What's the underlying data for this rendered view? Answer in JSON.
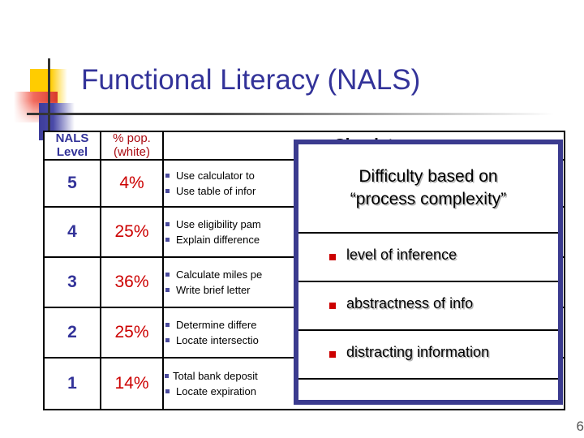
{
  "slide": {
    "title": "Functional Literacy (NALS)",
    "title_color": "#333399",
    "page_number": "6"
  },
  "table": {
    "headers": {
      "level": "NALS\nLevel",
      "level_line1": "NALS",
      "level_line2": "Level",
      "pct_line1": "% pop.",
      "pct_line2": "(white)",
      "tasks": "Simulat"
    },
    "header_colors": {
      "level": "#333399",
      "pct": "#AA0B12",
      "tasks": "#000000"
    },
    "rows": [
      {
        "level": "5",
        "pct": "4%",
        "tasks": [
          "Use calculator to",
          "Use table of infor"
        ]
      },
      {
        "level": "4",
        "pct": "25%",
        "tasks": [
          "Use eligibility pam",
          "Explain difference"
        ]
      },
      {
        "level": "3",
        "pct": "36%",
        "tasks": [
          "Calculate miles pe",
          "Write brief letter"
        ]
      },
      {
        "level": "2",
        "pct": "25%",
        "tasks": [
          "Determine differe",
          "Locate intersectio"
        ]
      },
      {
        "level": "1",
        "pct": "14%",
        "tasks": [
          "Total bank deposit",
          "Locate expiration"
        ]
      }
    ]
  },
  "callout": {
    "heading_line1": "Difficulty based on",
    "heading_line2": "“process complexity”",
    "border_color": "#3B3B8F",
    "bullet_color": "#CC0000",
    "items": [
      "level of inference",
      "abstractness of info",
      "distracting information"
    ]
  }
}
